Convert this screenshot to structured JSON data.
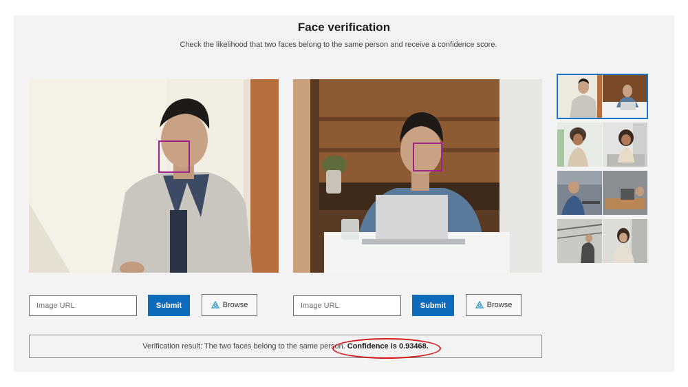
{
  "header": {
    "title": "Face verification",
    "subtitle": "Check the likelihood that two faces belong to the same person and receive a confidence score."
  },
  "left": {
    "url_placeholder": "Image URL",
    "submit_label": "Submit",
    "browse_label": "Browse"
  },
  "right": {
    "url_placeholder": "Image URL",
    "submit_label": "Submit",
    "browse_label": "Browse"
  },
  "result": {
    "text": "Verification result: The two faces belong to the same person.",
    "confidence_text": "Confidence is 0.93468."
  },
  "thumbnails": {
    "selected_index": 0,
    "count": 4
  },
  "colors": {
    "accent": "#0f6cbd",
    "face_box": "#a0208e",
    "highlight": "#d41a1a",
    "selected_outline": "#1a73c8"
  }
}
